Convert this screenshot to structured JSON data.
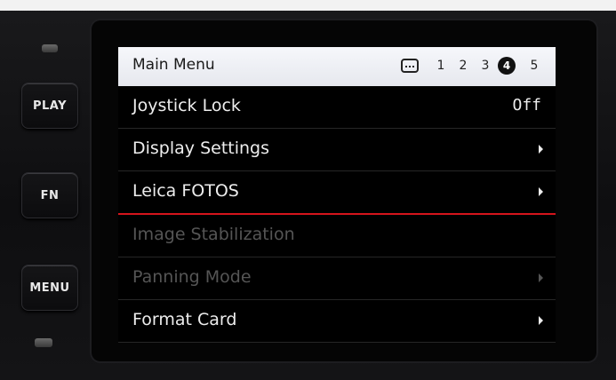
{
  "side_buttons": {
    "play": "PLAY",
    "fn": "FN",
    "menu": "MENU"
  },
  "menu": {
    "title": "Main Menu",
    "page_icon": "overview-grid-icon",
    "pages": [
      "1",
      "2",
      "3",
      "4",
      "5"
    ],
    "active_page": "4",
    "items": [
      {
        "label": "Joystick Lock",
        "value": "Off",
        "enabled": true
      },
      {
        "label": "Display Settings",
        "submenu": true,
        "enabled": true
      },
      {
        "label": "Leica FOTOS",
        "submenu": true,
        "enabled": true,
        "selected": true
      },
      {
        "label": "Image Stabilization",
        "enabled": false
      },
      {
        "label": "Panning Mode",
        "submenu": true,
        "enabled": false
      },
      {
        "label": "Format Card",
        "submenu": true,
        "enabled": true
      }
    ]
  },
  "colors": {
    "header_bg": "#eceef3",
    "selection_underline": "#d4141c",
    "disabled_text": "#555555"
  }
}
